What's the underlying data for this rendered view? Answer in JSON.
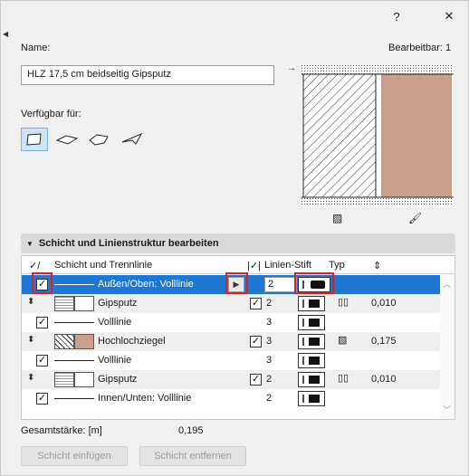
{
  "window": {
    "help_label": "?",
    "close_label": "✕"
  },
  "name": {
    "label": "Name:",
    "editable_label": "Bearbeitbar: 1",
    "value": "HLZ 17,5 cm beidseitig Gipsputz"
  },
  "available": {
    "label": "Verfügbar für:"
  },
  "section": {
    "title": "Schicht und Linienstruktur bearbeiten"
  },
  "columns": {
    "layer": "Schicht und Trennlinie",
    "pen": "Linien-Stift",
    "type": "Typ"
  },
  "rows": [
    {
      "kind": "line",
      "label": "Außen/Oben: Volllinie",
      "pen": "2"
    },
    {
      "kind": "layer",
      "label": "Gipsputz",
      "pen": "2",
      "thickness": "0,010"
    },
    {
      "kind": "line",
      "label": "Volllinie",
      "pen": "3"
    },
    {
      "kind": "layer",
      "label": "Hochlochziegel",
      "pen": "3",
      "thickness": "0,175"
    },
    {
      "kind": "line",
      "label": "Volllinie",
      "pen": "3"
    },
    {
      "kind": "layer",
      "label": "Gipsputz",
      "pen": "2",
      "thickness": "0,010"
    },
    {
      "kind": "line",
      "label": "Innen/Unten: Volllinie",
      "pen": "2"
    }
  ],
  "total": {
    "label": "Gesamtstärke: [m]",
    "value": "0,195"
  },
  "buttons": {
    "insert": "Schicht einfügen",
    "remove": "Schicht entfernen"
  },
  "colors": {
    "selection": "#1e78d2",
    "brick": "#c8a08c",
    "highlight": "#e02020"
  }
}
